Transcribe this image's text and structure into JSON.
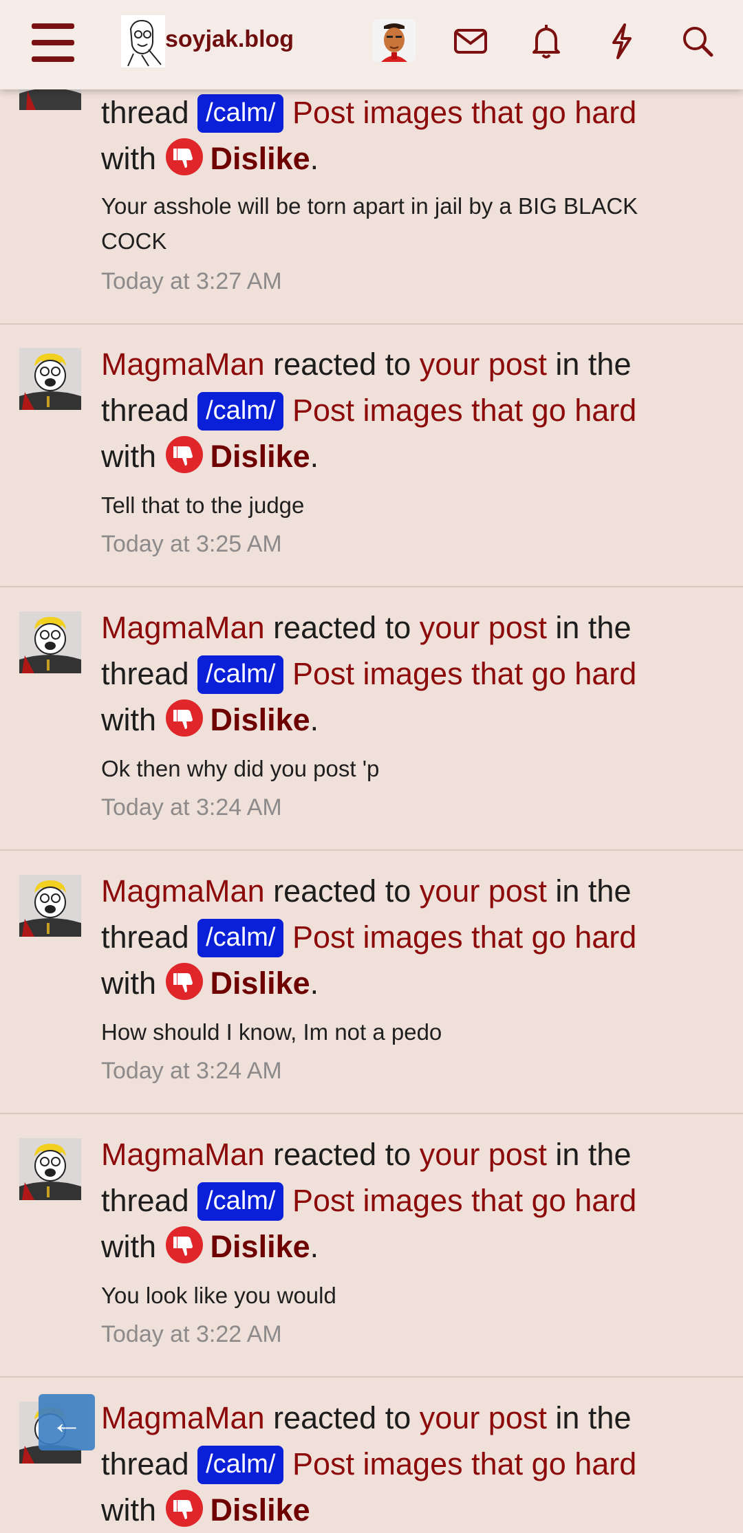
{
  "header": {
    "site_name": "soyjak.blog",
    "icons": [
      "menu-icon",
      "mail-icon",
      "bell-icon",
      "lightning-icon",
      "search-icon"
    ],
    "accent_color": "#6e0e0e"
  },
  "notifications": [
    {
      "user": "",
      "reacted": "",
      "your_post": "",
      "in_the": "",
      "thread_word": "thread",
      "tag": "/calm/",
      "thread_title": "Post images that go hard",
      "with": "with",
      "reaction": "Dislike",
      "period": ".",
      "snippet": "Your asshole will be torn apart in jail by a BIG BLACK COCK",
      "time": "Today at 3:27 AM"
    },
    {
      "user": "MagmaMan",
      "reacted": "reacted to",
      "your_post": "your post",
      "in_the": "in the",
      "thread_word": "thread",
      "tag": "/calm/",
      "thread_title": "Post images that go hard",
      "with": "with",
      "reaction": "Dislike",
      "period": ".",
      "snippet": "Tell that to the judge",
      "time": "Today at 3:25 AM"
    },
    {
      "user": "MagmaMan",
      "reacted": "reacted to",
      "your_post": "your post",
      "in_the": "in the",
      "thread_word": "thread",
      "tag": "/calm/",
      "thread_title": "Post images that go hard",
      "with": "with",
      "reaction": "Dislike",
      "period": ".",
      "snippet": "Ok then why did you post 'p",
      "time": "Today at 3:24 AM"
    },
    {
      "user": "MagmaMan",
      "reacted": "reacted to",
      "your_post": "your post",
      "in_the": "in the",
      "thread_word": "thread",
      "tag": "/calm/",
      "thread_title": "Post images that go hard",
      "with": "with",
      "reaction": "Dislike",
      "period": ".",
      "snippet": "How should I know, Im not a pedo",
      "time": "Today at 3:24 AM"
    },
    {
      "user": "MagmaMan",
      "reacted": "reacted to",
      "your_post": "your post",
      "in_the": "in the",
      "thread_word": "thread",
      "tag": "/calm/",
      "thread_title": "Post images that go hard",
      "with": "with",
      "reaction": "Dislike",
      "period": ".",
      "snippet": "You look like you would",
      "time": "Today at 3:22 AM"
    },
    {
      "user": "MagmaMan",
      "reacted": "reacted to",
      "your_post": "your post",
      "in_the": "in the",
      "thread_word": "thread",
      "tag": "/calm/",
      "thread_title": "Post images that go hard",
      "with": "with",
      "reaction": "Dislike",
      "period": ".",
      "snippet": "",
      "time": ""
    }
  ],
  "back_button": {
    "icon": "arrow-left-icon"
  }
}
